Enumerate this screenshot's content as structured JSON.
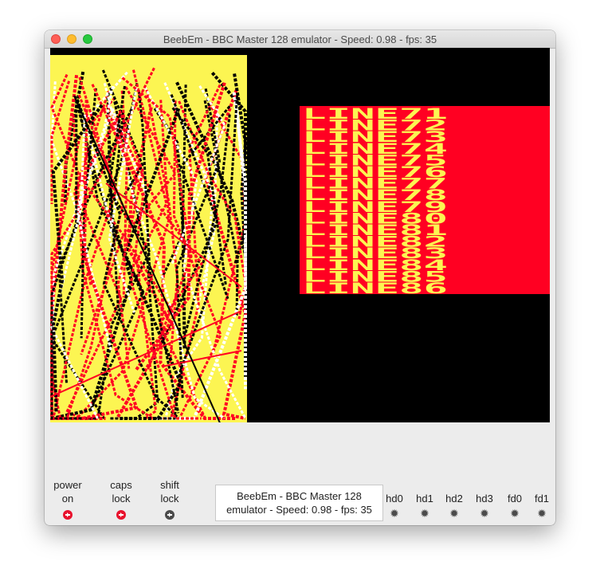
{
  "window": {
    "title": "BeebEm - BBC Master 128 emulator - Speed: 0.98 - fps: 35"
  },
  "screen": {
    "colors": {
      "yellow": "#fcf552",
      "red": "#ff0022",
      "black": "#000000",
      "white": "#ffffff"
    },
    "lines": [
      "LINE71",
      "LINE72",
      "LINE73",
      "LINE74",
      "LINE75",
      "LINE76",
      "LINE77",
      "LINE78",
      "LINE79",
      "LINE80",
      "LINE81",
      "LINE82",
      "LINE83",
      "LINE84",
      "LINE85",
      "LINE86"
    ]
  },
  "status": {
    "power": {
      "line1": "power",
      "line2": "on",
      "icon": "led-on-icon"
    },
    "caps": {
      "line1": "caps",
      "line2": "lock",
      "icon": "led-on-icon"
    },
    "shift": {
      "line1": "shift",
      "line2": "lock",
      "icon": "led-off-icon"
    },
    "drives": [
      "hd0",
      "hd1",
      "hd2",
      "hd3",
      "fd0",
      "fd1"
    ],
    "tooltip": {
      "line1": "BeebEm - BBC Master 128",
      "line2": "emulator - Speed: 0.98 - fps: 35"
    }
  }
}
